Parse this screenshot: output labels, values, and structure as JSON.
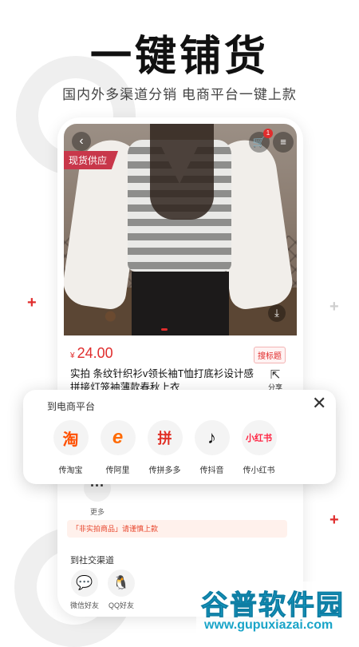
{
  "headline": "一键铺货",
  "subline": "国内外多渠道分销 电商平台一键上款",
  "product": {
    "tag": "现货供应",
    "cart_count": "1",
    "currency": "¥",
    "price": "24.00",
    "grab_title": "搜标题",
    "title": "实拍 条纹针织衫v领长袖T恤打底衫设计感拼接灯笼袖薄款春秋上衣",
    "share_label": "分享",
    "icons": [
      "back-arrow-icon",
      "cart-icon",
      "menu-icon",
      "download-icon"
    ]
  },
  "sheet": {
    "title": "到电商平台",
    "platforms": [
      {
        "label": "传淘宝",
        "glyph": "淘",
        "color": "#ff5000"
      },
      {
        "label": "传阿里",
        "glyph": "e",
        "color": "#ff6a00"
      },
      {
        "label": "传拼多多",
        "glyph": "拼",
        "color": "#e02e24"
      },
      {
        "label": "传抖音",
        "glyph": "♪",
        "color": "#111111"
      },
      {
        "label": "传小红书",
        "glyph": "小红书",
        "color": "#ff2442"
      }
    ]
  },
  "more_label": "更多",
  "warning": "「非实拍商品」请谨慎上款",
  "social": {
    "title": "到社交渠道",
    "items": [
      {
        "label": "微信好友",
        "color": "#2aae67"
      },
      {
        "label": "QQ好友",
        "color": "#111111"
      }
    ]
  },
  "watermark": {
    "cn": "谷普软件园",
    "en": "www.gupuxiazai.com"
  }
}
